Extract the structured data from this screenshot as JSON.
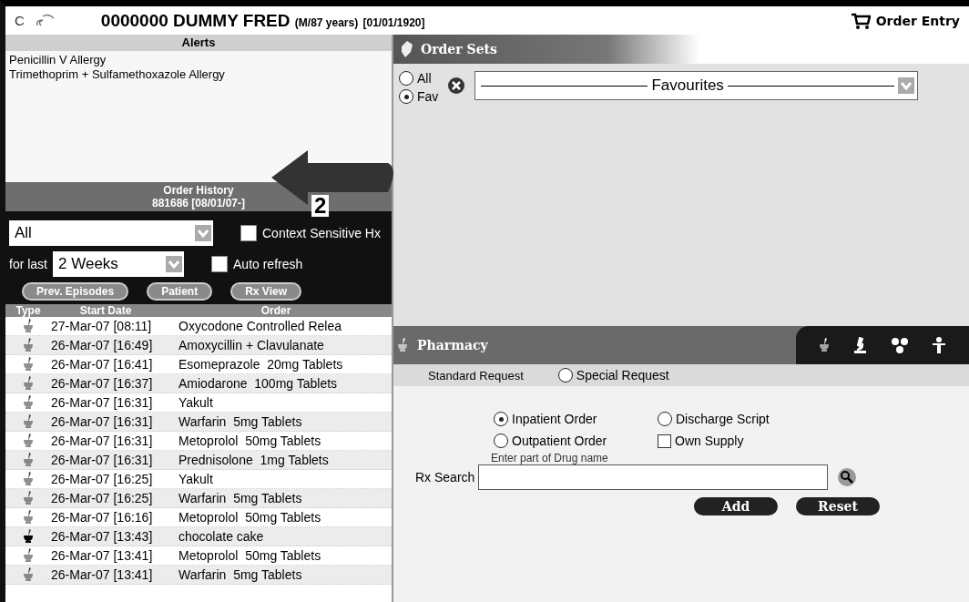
{
  "header": {
    "code": "C",
    "patient": "0000000 DUMMY FRED",
    "details": "(M/87 years)",
    "dob": "[01/01/1920]",
    "module": "Order Entry"
  },
  "alerts": {
    "title": "Alerts",
    "items": [
      "Penicillin V Allergy",
      "Trimethoprim + Sulfamethoxazole Allergy"
    ]
  },
  "annotation": {
    "label": "2"
  },
  "order_history": {
    "title": "Order History",
    "subtitle": "881686 [08/01/07-]",
    "filter": {
      "value": "All"
    },
    "context_sensitive": {
      "label": "Context Sensitive Hx",
      "checked": false
    },
    "period_label": "for last",
    "period": {
      "value": "2 Weeks"
    },
    "auto_refresh": {
      "label": "Auto refresh",
      "checked": false
    },
    "buttons": [
      "Prev. Episodes",
      "Patient",
      "Rx View"
    ],
    "columns": [
      "Type",
      "Start Date",
      "Order"
    ],
    "rows": [
      {
        "kind": "light",
        "start": "27-Mar-07 [08:11]",
        "order": "Oxycodone Controlled Relea"
      },
      {
        "kind": "light",
        "start": "26-Mar-07 [16:49]",
        "order": "Amoxycillin + Clavulanate"
      },
      {
        "kind": "light",
        "start": "26-Mar-07 [16:41]",
        "order": "Esomeprazole  20mg Tablets"
      },
      {
        "kind": "light",
        "start": "26-Mar-07 [16:37]",
        "order": "Amiodarone  100mg Tablets"
      },
      {
        "kind": "light",
        "start": "26-Mar-07 [16:31]",
        "order": "Yakult"
      },
      {
        "kind": "light",
        "start": "26-Mar-07 [16:31]",
        "order": "Warfarin  5mg Tablets"
      },
      {
        "kind": "light",
        "start": "26-Mar-07 [16:31]",
        "order": "Metoprolol  50mg Tablets"
      },
      {
        "kind": "light",
        "start": "26-Mar-07 [16:31]",
        "order": "Prednisolone  1mg Tablets"
      },
      {
        "kind": "light",
        "start": "26-Mar-07 [16:25]",
        "order": "Yakult"
      },
      {
        "kind": "light",
        "start": "26-Mar-07 [16:25]",
        "order": "Warfarin  5mg Tablets"
      },
      {
        "kind": "light",
        "start": "26-Mar-07 [16:16]",
        "order": "Metoprolol  50mg Tablets"
      },
      {
        "kind": "dark",
        "start": "26-Mar-07 [13:43]",
        "order": "chocolate cake"
      },
      {
        "kind": "light",
        "start": "26-Mar-07 [13:41]",
        "order": "Metoprolol  50mg Tablets"
      },
      {
        "kind": "light",
        "start": "26-Mar-07 [13:41]",
        "order": "Warfarin  5mg Tablets"
      }
    ]
  },
  "order_sets": {
    "title": "Order Sets",
    "options": [
      {
        "label": "All",
        "selected": false
      },
      {
        "label": "Fav",
        "selected": true
      }
    ],
    "list": {
      "value": "Favourites"
    }
  },
  "pharmacy": {
    "title": "Pharmacy",
    "standard_request": "Standard Request",
    "special_request": {
      "label": "Special Request",
      "selected": false
    },
    "order_types": [
      {
        "label": "Inpatient Order",
        "selected": true
      },
      {
        "label": "Discharge Script",
        "selected": false
      },
      {
        "label": "Outpatient Order",
        "selected": false
      }
    ],
    "own_supply": {
      "label": "Own Supply",
      "checked": false
    },
    "search": {
      "hint": "Enter part of Drug name",
      "label": "Rx Search"
    },
    "buttons": [
      "Add",
      "Reset"
    ]
  }
}
